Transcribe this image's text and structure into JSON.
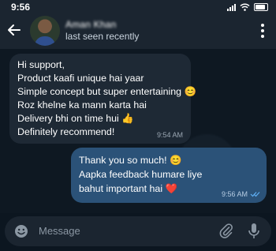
{
  "status": {
    "time": "9:56"
  },
  "header": {
    "contact_name": "Aman Khan",
    "last_seen": "last seen recently"
  },
  "messages": [
    {
      "direction": "incoming",
      "lines": [
        "Hi support,",
        "Product kaafi unique hai yaar",
        "Simple concept but super entertaining 😊",
        "Roz khelne ka mann karta hai",
        "Delivery bhi on time hui 👍",
        "Definitely recommend!"
      ],
      "time": "9:54 AM"
    },
    {
      "direction": "outgoing",
      "lines": [
        "Thank you so much! 😊",
        "Aapka feedback humare liye",
        "bahut important hai ❤️"
      ],
      "time": "9:56 AM",
      "status": "read"
    }
  ],
  "composer": {
    "placeholder": "Message"
  },
  "icons": {
    "back": "arrow-left-icon",
    "menu": "kebab-menu-icon",
    "emoji": "emoji-icon",
    "attach": "paperclip-icon",
    "mic": "microphone-icon",
    "read": "double-check-icon"
  },
  "colors": {
    "header_bg": "#1b2530",
    "chat_bg": "#0e1822",
    "incoming_bubble": "#1e2935",
    "outgoing_bubble": "#2b5278",
    "read_check": "#5fb0f5"
  }
}
